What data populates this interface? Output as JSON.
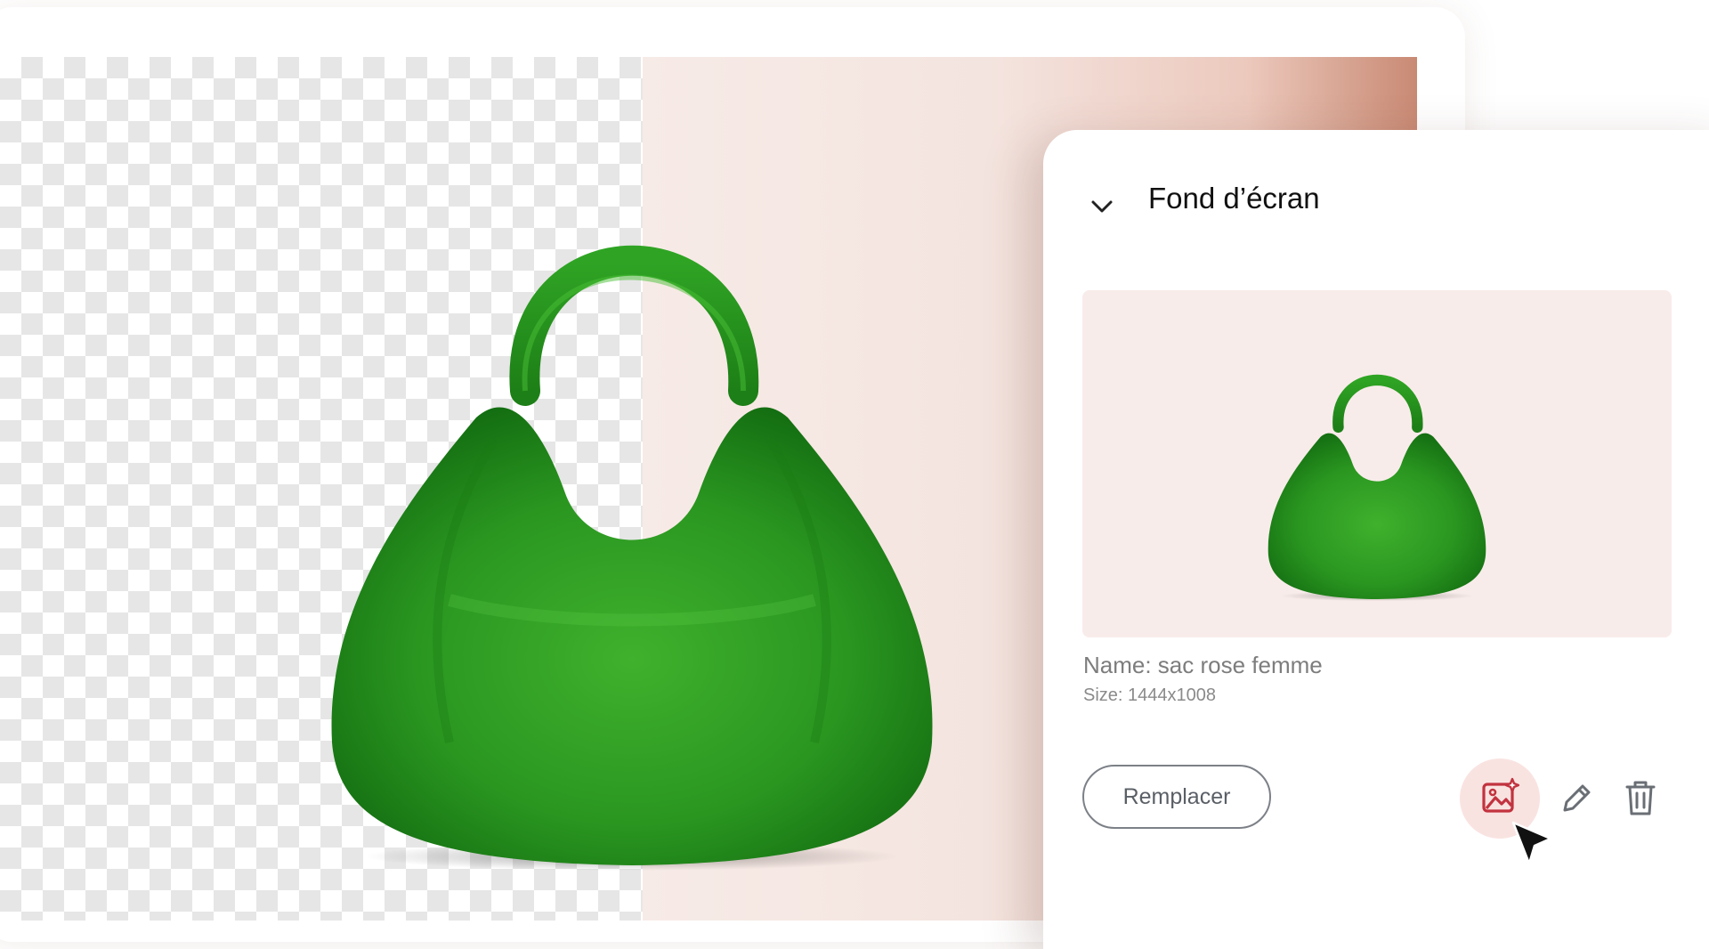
{
  "panel": {
    "title": "Fond d’écran",
    "collapse_icon": "chevron-down-icon",
    "preview": {
      "name_text": "Name: sac rose femme",
      "size_text": "Size: 1444x1008"
    },
    "actions": {
      "replace_label": "Remplacer",
      "ai_background_icon": "image-sparkle-icon",
      "edit_icon": "pencil-icon",
      "delete_icon": "trash-icon"
    }
  },
  "canvas": {
    "left_background": "transparent-checkerboard",
    "right_background_color": "#f4e4df",
    "product": "green-handbag"
  },
  "colors": {
    "accent": "#c2333f",
    "accent_bg": "#f9e3e1",
    "bag_green": "#2e9a22",
    "text_muted": "#7d7d7d"
  }
}
